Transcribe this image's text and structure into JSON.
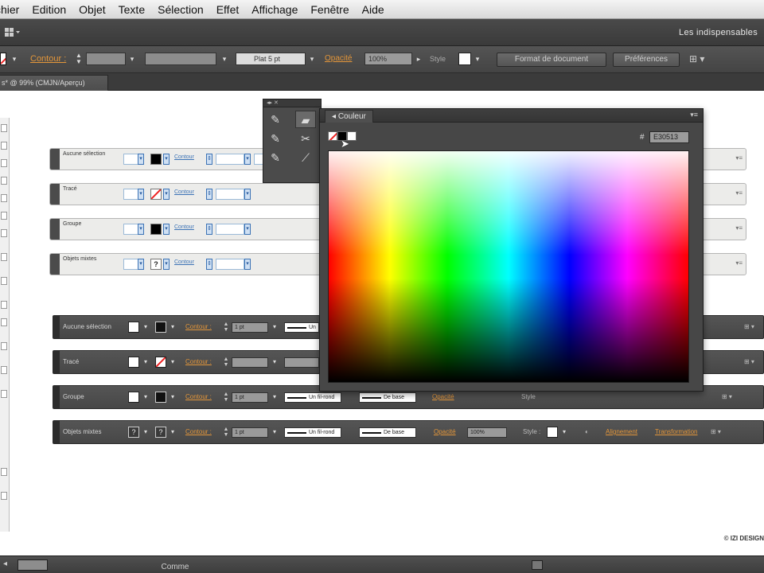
{
  "menu": [
    "chier",
    "Edition",
    "Objet",
    "Texte",
    "Sélection",
    "Effet",
    "Affichage",
    "Fenêtre",
    "Aide"
  ],
  "appbar": {
    "workspace": "Les indispensables"
  },
  "control": {
    "contour_label": "Contour :",
    "stroke_profile": "Plat 5 pt",
    "opacity_label": "Opacité",
    "opacity_value": "100%",
    "style_label": "Style",
    "doc_format_button": "Format de document",
    "prefs_button": "Préférences"
  },
  "document_tab": {
    "title": "s* @ 99% (CMJN/Aperçu)"
  },
  "light_panels": [
    {
      "label": "Aucune sélection",
      "control": "Contour"
    },
    {
      "label": "Tracé",
      "control": "Contour"
    },
    {
      "label": "Groupe",
      "control": "Contour"
    },
    {
      "label": "Objets mixtes",
      "control": "Contour"
    }
  ],
  "dark_panels": [
    {
      "label": "Aucune sélection",
      "contour": "Contour :",
      "weight": "1 pt",
      "stroke": "Un"
    },
    {
      "label": "Tracé",
      "contour": "Contour :",
      "weight": "",
      "stroke": ""
    },
    {
      "label": "Groupe",
      "contour": "Contour :",
      "weight": "1 pt",
      "stroke": "Un fil-rond",
      "stroke2": "De base",
      "opacity": "Opacité",
      "style": "Style"
    },
    {
      "label": "Objets mixtes",
      "contour": "Contour :",
      "weight": "1 pt",
      "stroke": "Un fil-rond",
      "stroke2": "De base",
      "opacity": "Opacité",
      "opacity_value": "100%",
      "style": "Style :",
      "align": "Alignement",
      "transform": "Transformation"
    }
  ],
  "color_panel": {
    "title": "Couleur",
    "hex_sign": "#",
    "hex_value": "E30513"
  },
  "footer": {
    "copyright": "© IZI DESIGN",
    "status_text": "Comme"
  },
  "colors": {
    "accent_orange": "#e3963a",
    "panel_dark": "#474747",
    "selected_red": "#E30513"
  }
}
